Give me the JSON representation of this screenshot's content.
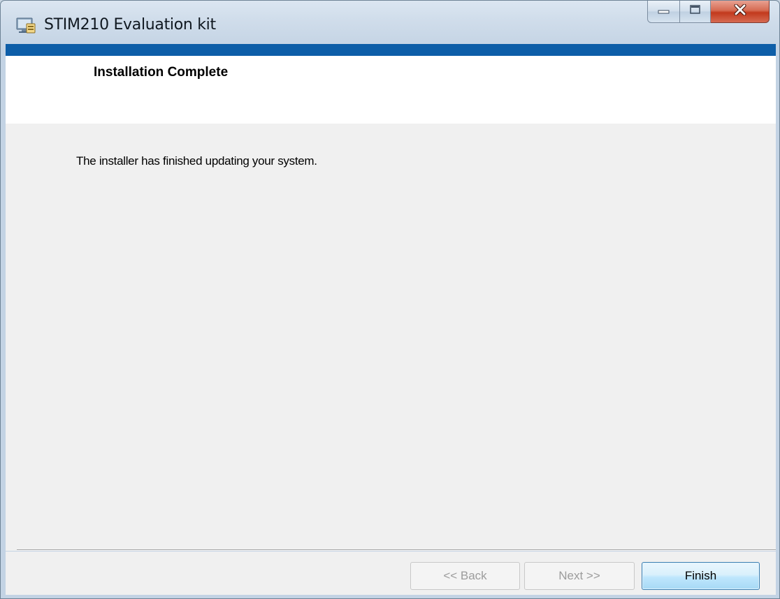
{
  "window": {
    "title": "STIM210 Evaluation kit",
    "icon": "installer-icon"
  },
  "caption_buttons": {
    "minimize_icon": "minimize-icon",
    "maximize_icon": "maximize-icon",
    "close_icon": "close-icon"
  },
  "header": {
    "title": "Installation Complete"
  },
  "content": {
    "message": "The installer has finished updating your system."
  },
  "footer": {
    "back_label": "<< Back",
    "next_label": "Next >>",
    "finish_label": "Finish"
  },
  "colors": {
    "banner_strip": "#0d5ea8",
    "panel_background": "#f0f0f0",
    "close_button": "#c2391c",
    "default_button_border": "#3c7fb1"
  }
}
